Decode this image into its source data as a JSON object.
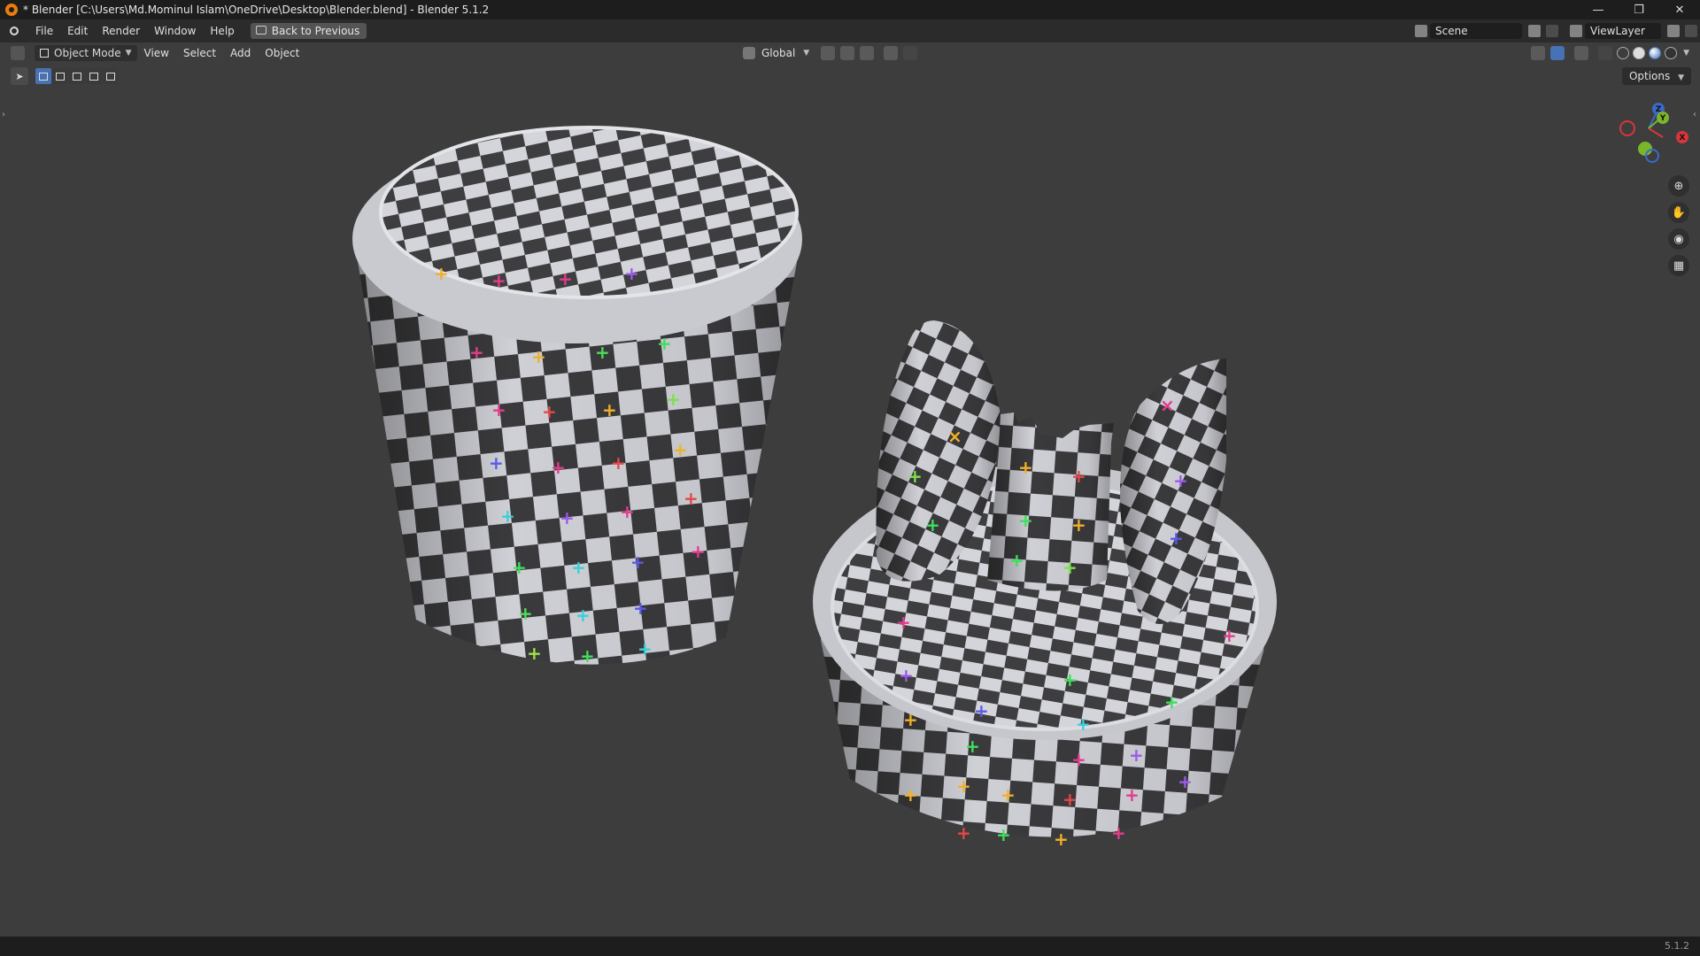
{
  "window": {
    "title": "* Blender [C:\\Users\\Md.Mominul Islam\\OneDrive\\Desktop\\Blender.blend] - Blender 5.1.2",
    "controls": {
      "minimize": "—",
      "maximize": "❐",
      "close": "✕"
    }
  },
  "menu": {
    "items": [
      "File",
      "Edit",
      "Render",
      "Window",
      "Help"
    ],
    "back_button": "Back to Previous"
  },
  "scene": {
    "name": "Scene",
    "view_layer": "ViewLayer"
  },
  "viewport_header": {
    "mode": "Object Mode",
    "items": [
      "View",
      "Select",
      "Add",
      "Object"
    ],
    "transform_orientation": "Global"
  },
  "options_label": "Options",
  "gizmo": {
    "z": "Z",
    "y": "Y",
    "x": "X"
  },
  "icons": {
    "zoom": "zoom-icon",
    "pan": "hand-icon",
    "camera": "camera-icon",
    "grid": "grid-icon"
  },
  "status": {
    "version": "5.1.2"
  },
  "colors": {
    "accent": "#4772b3",
    "viewport_bg": "#3d3d3d",
    "header_bg": "#2b2b2b",
    "titlebar_bg": "#1d1d1d",
    "checker_light": "#cfd0d6",
    "checker_dark": "#3a3a3c"
  }
}
